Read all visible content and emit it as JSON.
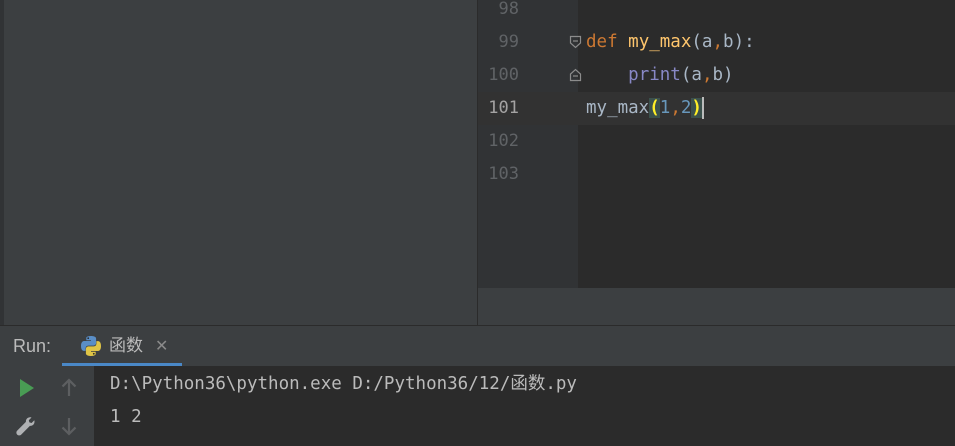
{
  "editor": {
    "lines": [
      {
        "number": "98"
      },
      {
        "number": "99",
        "def_kw": "def",
        "fn_name": "my_max",
        "open": "(",
        "p1": "a",
        "comma": ",",
        "p2": "b",
        "close_colon": "):"
      },
      {
        "number": "100",
        "indent": "    ",
        "builtin": "print",
        "open": "(",
        "p1": "a",
        "comma": ",",
        "p2": "b",
        "close": ")"
      },
      {
        "number": "101",
        "call_name": "my_max",
        "open": "(",
        "arg1": "1",
        "comma": ",",
        "arg2": "2",
        "close": ")"
      },
      {
        "number": "102"
      },
      {
        "number": "103"
      }
    ],
    "current_line": "101"
  },
  "run_panel": {
    "label": "Run:",
    "tab_label": "函数",
    "tab_close": "✕",
    "tab_icon": "python-icon",
    "toolbar": [
      {
        "icon": "run-icon",
        "color": "#499c54"
      },
      {
        "icon": "arrow-up-icon"
      },
      {
        "icon": "wrench-icon"
      },
      {
        "icon": "arrow-down-icon"
      }
    ],
    "console": [
      "D:\\Python36\\python.exe D:/Python36/12/函数.py",
      "1 2"
    ]
  },
  "colors": {
    "keyword": "#cc7832",
    "function_name": "#ffc66d",
    "builtin": "#8888c6",
    "number": "#6897bb",
    "accent": "#4a88c7"
  }
}
